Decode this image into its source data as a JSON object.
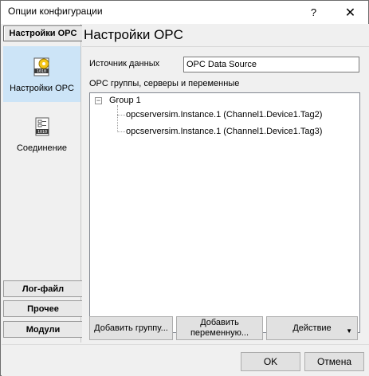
{
  "window": {
    "title": "Опции конфигурации",
    "help_glyph": "?",
    "close_glyph": "✕"
  },
  "sidebar": {
    "section_header": "Настройки OPC",
    "items": [
      {
        "label": "Настройки OPC",
        "icon": "opc-settings-icon",
        "selected": true
      },
      {
        "label": "Соединение",
        "icon": "connection-icon",
        "selected": false
      }
    ],
    "bottom_buttons": [
      {
        "label": "Лог-файл"
      },
      {
        "label": "Прочее"
      },
      {
        "label": "Модули"
      }
    ]
  },
  "main": {
    "title": "Настройки OPC",
    "data_source_label": "Источник данных",
    "data_source_value": "OPC Data Source",
    "tree_label": "OPC группы, серверы и переменные",
    "tree": {
      "group": "Group 1",
      "collapse_glyph": "−",
      "children": [
        "opcserversim.Instance.1 (Channel1.Device1.Tag2)",
        "opcserversim.Instance.1 (Channel1.Device1.Tag3)"
      ]
    },
    "buttons": {
      "add_group": "Добавить группу...",
      "add_variable_line1": "Добавить",
      "add_variable_line2": "переменную...",
      "action": "Действие",
      "action_arrow": "▼"
    }
  },
  "footer": {
    "ok": "OK",
    "cancel": "Отмена"
  },
  "colors": {
    "selected_bg": "#cce4f7",
    "window_bg": "#f0f0f0"
  }
}
